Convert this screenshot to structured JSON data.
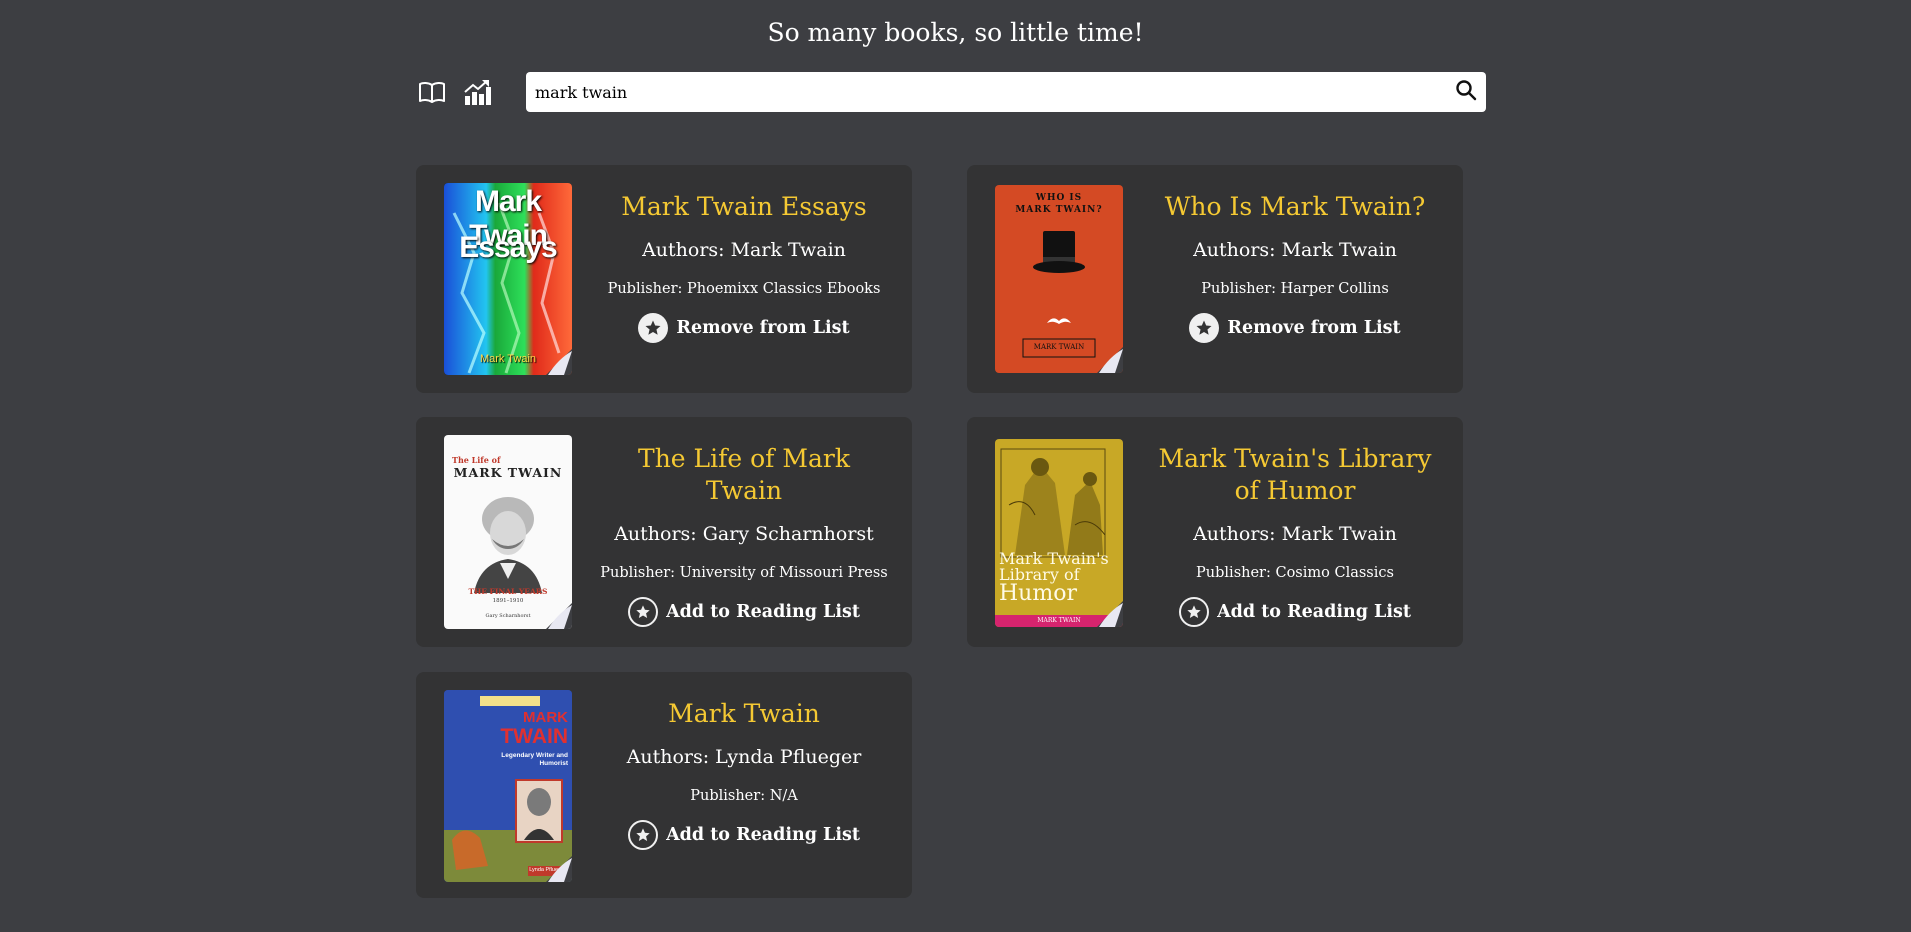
{
  "header": {
    "title": "So many books, so little time!"
  },
  "nav": {
    "icons": [
      "open-book-icon",
      "chart-icon"
    ]
  },
  "search": {
    "value": "mark twain",
    "placeholder": ""
  },
  "results": [
    {
      "title": "Mark Twain Essays",
      "authors": "Authors: Mark Twain",
      "publisher": "Publisher: Phoemixx Classics Ebooks",
      "action": "Remove from List",
      "in_list": true,
      "cover": {
        "line1": "Mark Twain",
        "line2": "Essays",
        "author": "Mark Twain"
      }
    },
    {
      "title": "Who Is Mark Twain?",
      "authors": "Authors: Mark Twain",
      "publisher": "Publisher: Harper Collins",
      "action": "Remove from List",
      "in_list": true,
      "cover": {
        "line1": "WHO IS",
        "line2": "MARK TWAIN?",
        "author": "MARK TWAIN"
      }
    },
    {
      "title": "The Life of Mark Twain",
      "authors": "Authors: Gary Scharnhorst",
      "publisher": "Publisher: University of Missouri Press",
      "action": "Add to Reading List",
      "in_list": false,
      "cover": {
        "line1": "The Life of",
        "line2": "MARK TWAIN",
        "line3": "THE FINAL YEARS",
        "years": "1891–1910",
        "author": "Gary Scharnhorst"
      }
    },
    {
      "title": "Mark Twain's Library of Humor",
      "authors": "Authors: Mark Twain",
      "publisher": "Publisher: Cosimo Classics",
      "action": "Add to Reading List",
      "in_list": false,
      "cover": {
        "line1": "Mark Twain's",
        "line2": "Library of",
        "line3": "Humor",
        "author": "MARK TWAIN"
      }
    },
    {
      "title": "Mark Twain",
      "authors": "Authors: Lynda Pflueger",
      "publisher": "Publisher: N/A",
      "action": "Add to Reading List",
      "in_list": false,
      "cover": {
        "line1": "MARK",
        "line2": "TWAIN",
        "line3": "Legendary Writer and Humorist",
        "author": "Lynda Pflueger"
      }
    }
  ],
  "colors": {
    "background": "#3d3e42",
    "card": "#333334",
    "title_accent": "#f5c933"
  }
}
